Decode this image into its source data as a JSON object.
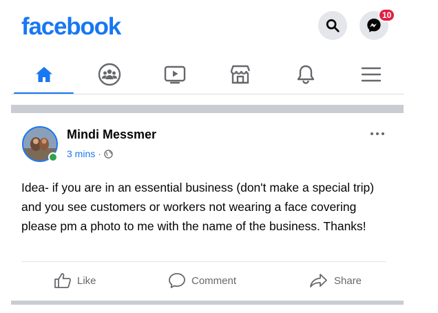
{
  "header": {
    "logo": "facebook",
    "search_icon": "search-icon",
    "messenger_icon": "messenger-icon",
    "messenger_badge": "10"
  },
  "nav": {
    "tabs": [
      {
        "name": "home",
        "icon": "home-icon",
        "active": true
      },
      {
        "name": "groups",
        "icon": "groups-icon",
        "active": false
      },
      {
        "name": "watch",
        "icon": "watch-icon",
        "active": false
      },
      {
        "name": "marketplace",
        "icon": "marketplace-icon",
        "active": false
      },
      {
        "name": "notifications",
        "icon": "bell-icon",
        "active": false
      },
      {
        "name": "menu",
        "icon": "menu-icon",
        "active": false
      }
    ]
  },
  "post": {
    "author": "Mindi Messmer",
    "time": "3 mins",
    "separator": "·",
    "privacy_icon": "globe-icon",
    "more_icon": "more-icon",
    "text": "Idea- if you are in an essential business (don't make a special trip) and you see customers or workers not wearing a face covering please pm a photo to me with the name of the business. Thanks!",
    "actions": {
      "like": "Like",
      "comment": "Comment",
      "share": "Share"
    }
  },
  "colors": {
    "brand": "#1877f2",
    "online": "#31a24c",
    "badge": "#e41e3f",
    "secondary_text": "#65676b"
  }
}
